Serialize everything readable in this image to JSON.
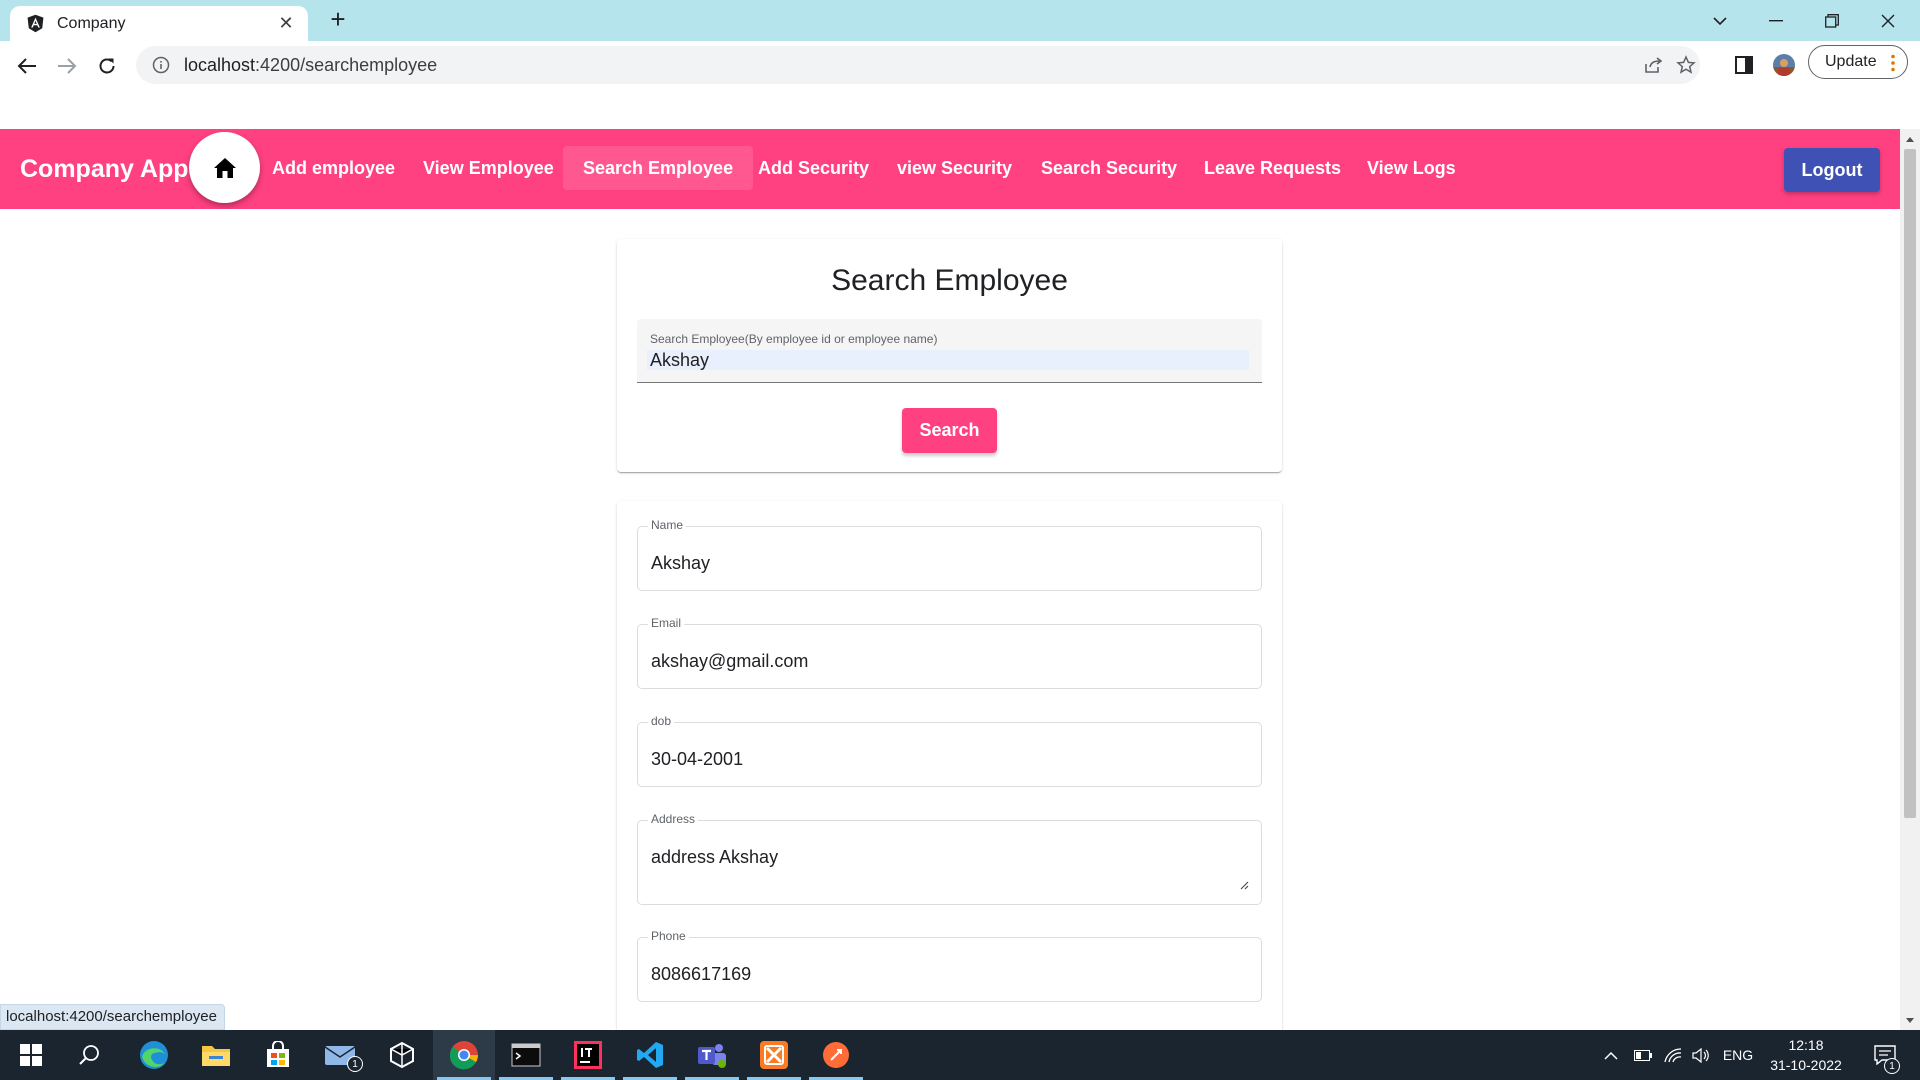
{
  "browser": {
    "tab_title": "Company",
    "url_host": "localhost",
    "url_rest": ":4200/searchemployee",
    "update_label": "Update",
    "status_link": "localhost:4200/searchemployee"
  },
  "header": {
    "brand": "Company App .",
    "nav": [
      {
        "label": "Add employee"
      },
      {
        "label": "View Employee"
      },
      {
        "label": "Search Employee",
        "active": true
      },
      {
        "label": "Add Security"
      },
      {
        "label": "view Security"
      },
      {
        "label": "Search Security"
      },
      {
        "label": "Leave Requests"
      },
      {
        "label": "View Logs"
      }
    ],
    "logout_label": "Logout",
    "accent_color": "#ff4081",
    "logout_color": "#3f51b5"
  },
  "search_card": {
    "title": "Search Employee",
    "field_label": "Search Employee(By employee id or employee name)",
    "field_value": "Akshay",
    "button_label": "Search"
  },
  "result": {
    "fields": [
      {
        "label": "Name",
        "value": "Akshay"
      },
      {
        "label": "Email",
        "value": "akshay@gmail.com"
      },
      {
        "label": "dob",
        "value": "30-04-2001"
      },
      {
        "label": "Address",
        "value": "address Akshay"
      },
      {
        "label": "Phone",
        "value": "8086617169"
      }
    ]
  },
  "taskbar": {
    "apps": [
      "windows-start",
      "search",
      "edge",
      "file-explorer",
      "microsoft-store",
      "mail",
      "dev-tool",
      "chrome",
      "terminal",
      "intellij",
      "vscode",
      "teams",
      "xampp",
      "postman"
    ],
    "mail_badge": "1",
    "language": "ENG",
    "time": "12:18",
    "date": "31-10-2022",
    "notification_badge": "1"
  }
}
